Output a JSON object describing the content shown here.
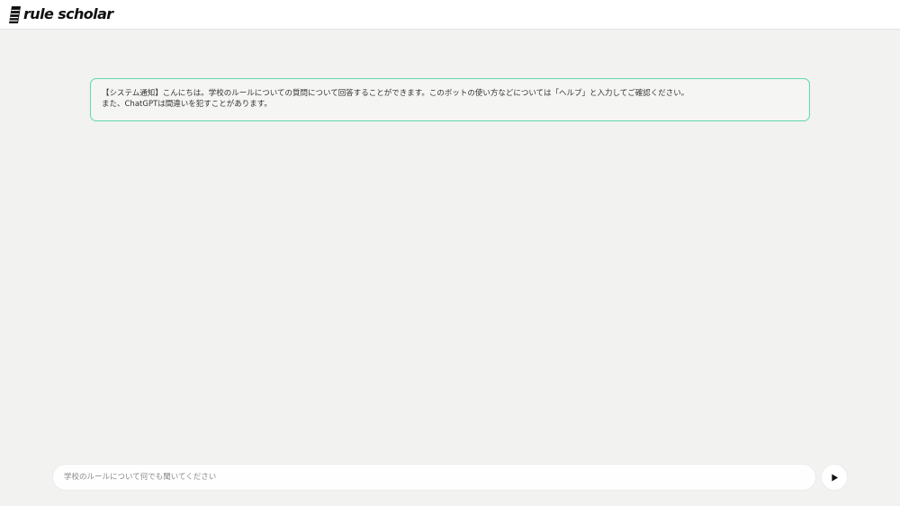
{
  "header": {
    "logo_text": "rule scholar"
  },
  "notice": {
    "line1": "【システム通知】こんにちは。学校のルールについての質問について回答することができます。このボットの使い方などについては「ヘルプ」と入力してご確認ください。",
    "line2": "また、ChatGPTは間違いを犯すことがあります。",
    "border_color": "#5fd9ad"
  },
  "composer": {
    "placeholder": "学校のルールについて何でも聞いてください",
    "send_icon": "play-icon"
  }
}
